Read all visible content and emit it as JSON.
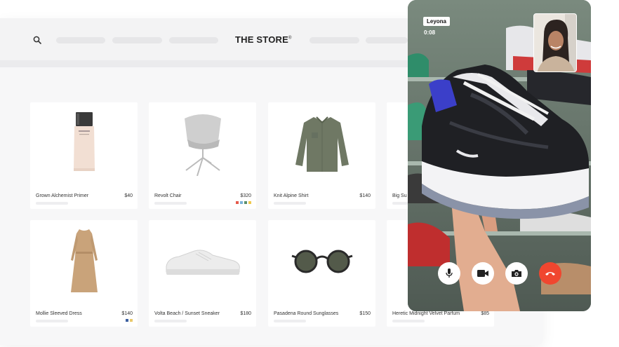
{
  "store": {
    "logo_bold": "THE STORE",
    "logo_mark": "®"
  },
  "products": [
    {
      "name": "Grown Alchemist Primer",
      "price": "$40"
    },
    {
      "name": "Revolt Chair",
      "price": "$320",
      "swatches": [
        "#e55a4b",
        "#7bb3d9",
        "#5b8f6d",
        "#f0c94e"
      ]
    },
    {
      "name": "Knit Alpine Shirt",
      "price": "$140"
    },
    {
      "name": "Big Su",
      "price": ""
    },
    {
      "name": "Mollie Sleeved Dress",
      "price": "$140",
      "swatches": [
        "#3c5fa0",
        "#e9c86a"
      ]
    },
    {
      "name": "Volta Beach / Sunset Sneaker",
      "price": "$180"
    },
    {
      "name": "Pasadena Round Sunglasses",
      "price": "$150"
    },
    {
      "name": "Heretic Midnight Velvet Parfum",
      "price": "$85"
    }
  ],
  "call": {
    "caller_name": "Leyona",
    "timer": "0:08",
    "controls": [
      "microphone-icon",
      "video-camera-icon",
      "switch-camera-icon",
      "end-call-icon"
    ],
    "end_call_color": "#f0462f"
  }
}
